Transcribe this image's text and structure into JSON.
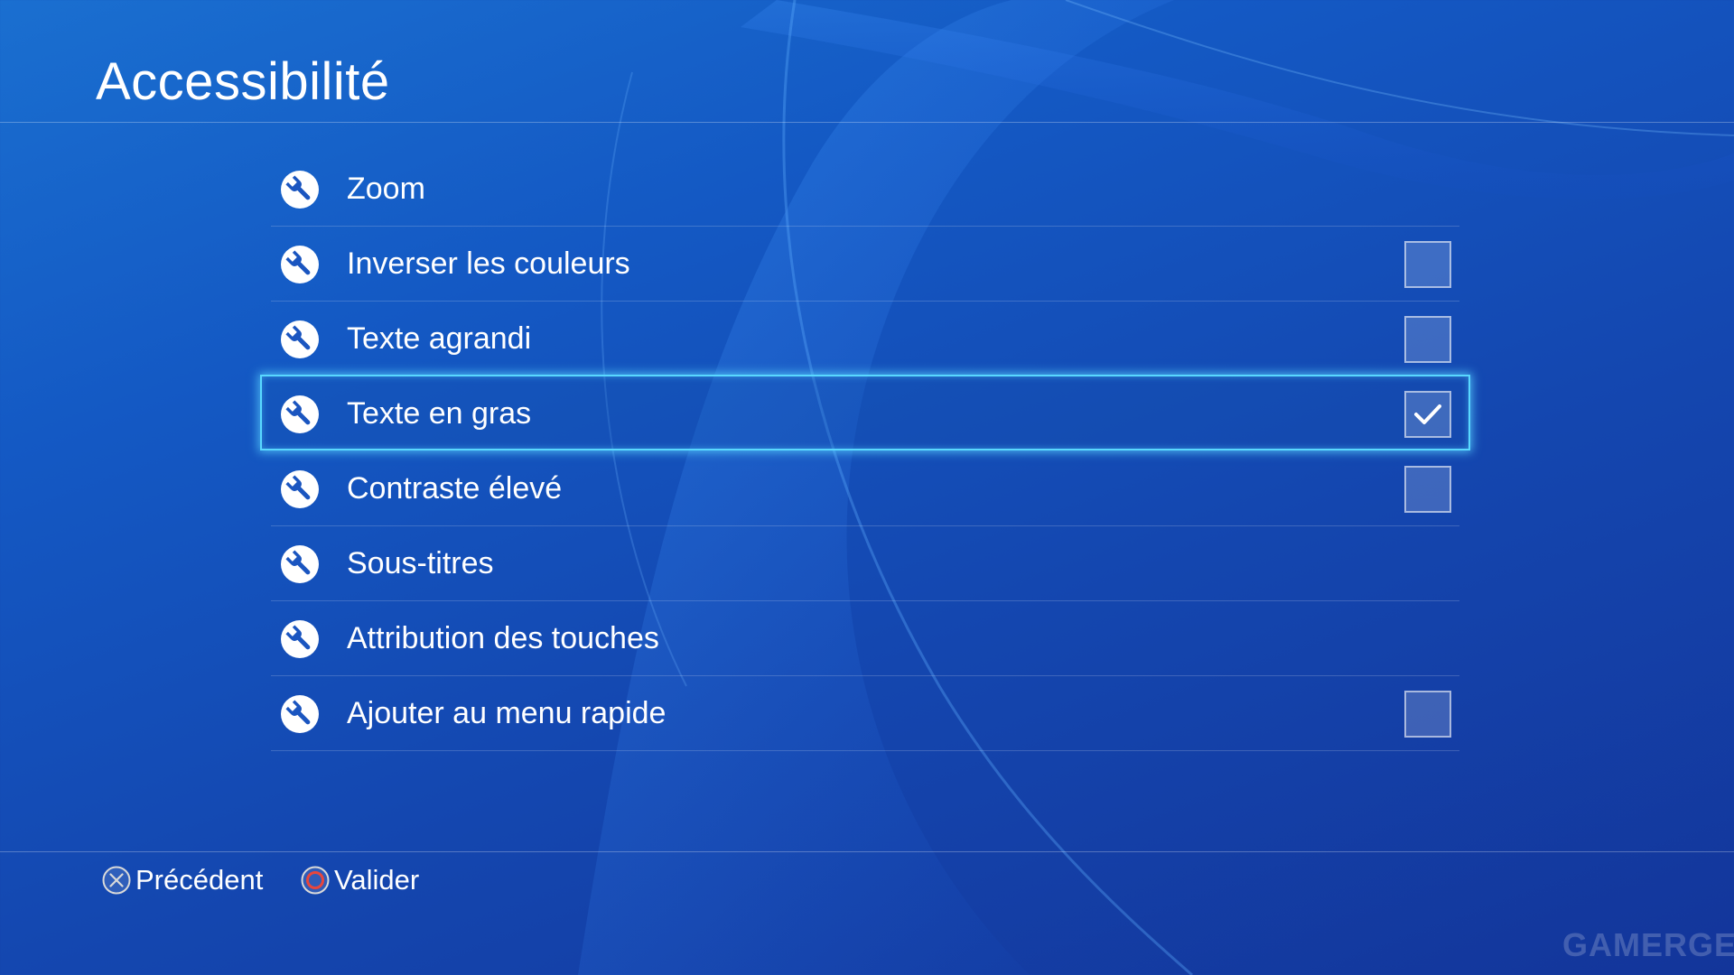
{
  "header": {
    "title": "Accessibilité"
  },
  "menu": {
    "selected_index": 3,
    "items": [
      {
        "label": "Zoom",
        "icon": "wrench-icon",
        "has_checkbox": false,
        "checked": false
      },
      {
        "label": "Inverser les couleurs",
        "icon": "wrench-icon",
        "has_checkbox": true,
        "checked": false
      },
      {
        "label": "Texte agrandi",
        "icon": "wrench-icon",
        "has_checkbox": true,
        "checked": false
      },
      {
        "label": "Texte en gras",
        "icon": "wrench-icon",
        "has_checkbox": true,
        "checked": true
      },
      {
        "label": "Contraste élevé",
        "icon": "wrench-icon",
        "has_checkbox": true,
        "checked": false
      },
      {
        "label": "Sous-titres",
        "icon": "wrench-icon",
        "has_checkbox": false,
        "checked": false
      },
      {
        "label": "Attribution des touches",
        "icon": "wrench-icon",
        "has_checkbox": false,
        "checked": false
      },
      {
        "label": "Ajouter au menu rapide",
        "icon": "wrench-icon",
        "has_checkbox": true,
        "checked": false
      }
    ]
  },
  "footer": {
    "back_label": "Précédent",
    "back_icon": "cross-button-icon",
    "confirm_label": "Valider",
    "confirm_icon": "circle-button-icon"
  },
  "watermark": {
    "text": "GAMERGEN"
  },
  "colors": {
    "focus": "#59d8ff",
    "circle_button": "#e8463c",
    "background_start": "#1a6fd0",
    "background_end": "#13359a"
  }
}
